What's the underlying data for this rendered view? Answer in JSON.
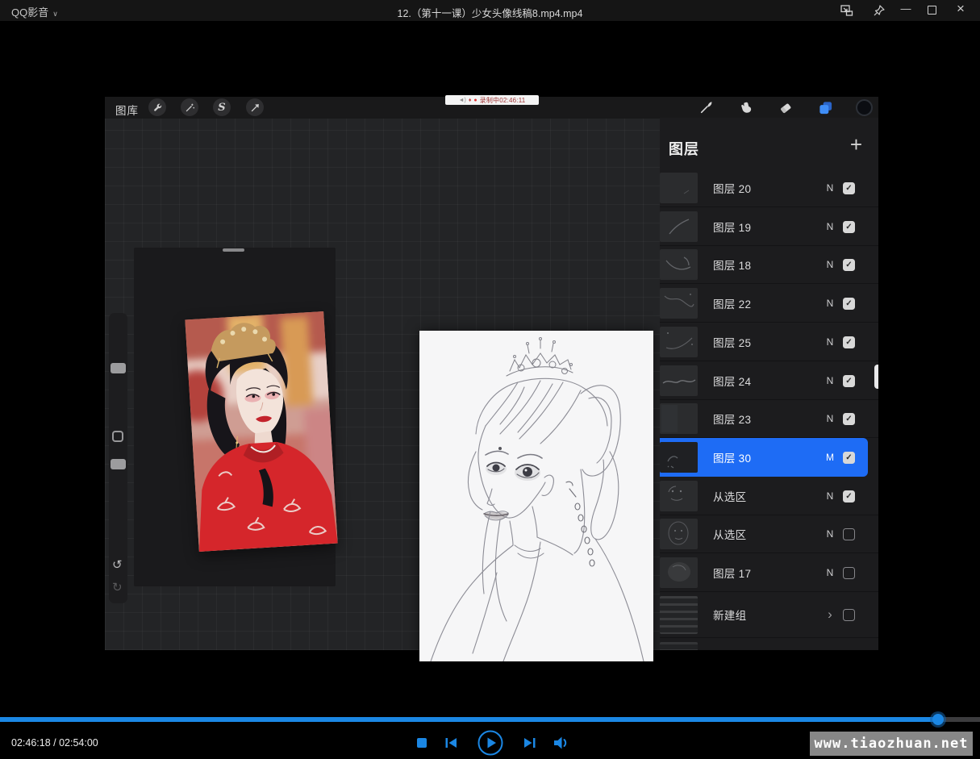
{
  "window": {
    "app_menu_label": "QQ影音",
    "title": "12.（第十一课）少女头像线稿8.mp4.mp4"
  },
  "player": {
    "accent_color": "#1b87e4",
    "progress_percent": 95.7,
    "time_display": "02:46:18 / 02:54:00",
    "watermark": "www.tiaozhuan.net"
  },
  "procreate": {
    "toolbar": {
      "gallery_label": "图库",
      "selection_glyph": "S",
      "recording_dot": "●",
      "recording_text": "录制中02:46:11"
    },
    "layers_panel": {
      "title": "图层",
      "selected_color": "#1e6cf5",
      "layers": [
        {
          "name": "图层 20",
          "blend": "N",
          "checked": true,
          "selected": false
        },
        {
          "name": "图层 19",
          "blend": "N",
          "checked": true,
          "selected": false
        },
        {
          "name": "图层 18",
          "blend": "N",
          "checked": true,
          "selected": false
        },
        {
          "name": "图层 22",
          "blend": "N",
          "checked": true,
          "selected": false
        },
        {
          "name": "图层 25",
          "blend": "N",
          "checked": true,
          "selected": false
        },
        {
          "name": "图层 24",
          "blend": "N",
          "checked": true,
          "selected": false
        },
        {
          "name": "图层 23",
          "blend": "N",
          "checked": true,
          "selected": false
        },
        {
          "name": "图层 30",
          "blend": "M",
          "checked": true,
          "selected": true
        },
        {
          "name": "从选区",
          "blend": "N",
          "checked": true,
          "selected": false
        },
        {
          "name": "从选区",
          "blend": "N",
          "checked": false,
          "selected": false
        },
        {
          "name": "图层 17",
          "blend": "N",
          "checked": false,
          "selected": false
        },
        {
          "name": "新建组",
          "blend": "",
          "checked": false,
          "selected": false,
          "group": true
        }
      ]
    }
  },
  "icons": {
    "plus": "+",
    "chevron_right": "›",
    "check": "✓",
    "minimize": "—",
    "close": "×",
    "caret_down": "∨",
    "undo": "↺",
    "redo": "↻",
    "speaker": "◄)",
    "record_lock": "🔒"
  }
}
